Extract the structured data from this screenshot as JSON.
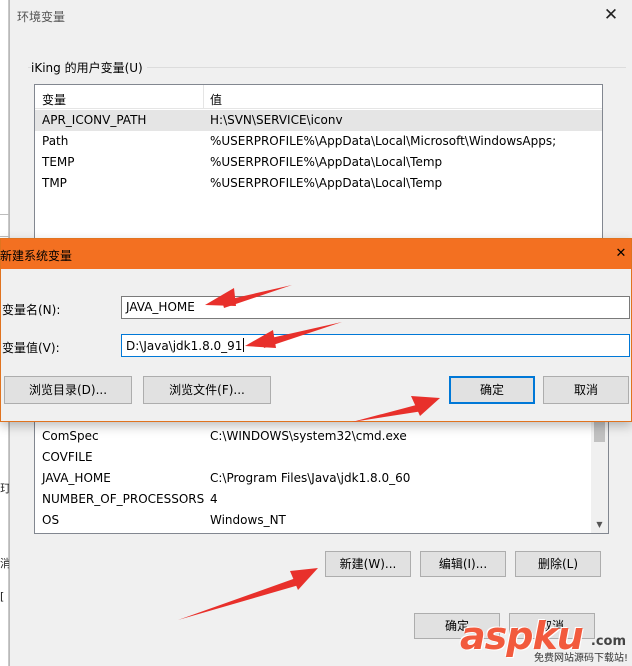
{
  "left_strip": {
    "chars": [
      "玎",
      "消",
      "["
    ]
  },
  "env_window": {
    "title": "环境变量",
    "close_glyph": "✕",
    "user_group_label": "iKing 的用户变量(U)",
    "user_vars": {
      "headers": [
        "变量",
        "值"
      ],
      "rows": [
        [
          "APR_ICONV_PATH",
          "H:\\SVN\\SERVICE\\iconv"
        ],
        [
          "Path",
          "%USERPROFILE%\\AppData\\Local\\Microsoft\\WindowsApps;"
        ],
        [
          "TEMP",
          "%USERPROFILE%\\AppData\\Local\\Temp"
        ],
        [
          "TMP",
          "%USERPROFILE%\\AppData\\Local\\Temp"
        ]
      ]
    },
    "system_vars": {
      "rows": [
        [
          "ComSpec",
          "C:\\WINDOWS\\system32\\cmd.exe"
        ],
        [
          "COVFILE",
          ""
        ],
        [
          "JAVA_HOME",
          "C:\\Program Files\\Java\\jdk1.8.0_60"
        ],
        [
          "NUMBER_OF_PROCESSORS",
          "4"
        ],
        [
          "OS",
          "Windows_NT"
        ]
      ]
    },
    "sys_buttons": {
      "new": "新建(W)...",
      "edit": "编辑(I)...",
      "delete": "删除(L)"
    },
    "footer_buttons": {
      "ok": "确定",
      "cancel": "取消"
    }
  },
  "dialog": {
    "title": "新建系统变量",
    "close_glyph": "✕",
    "name_label": "变量名(N):",
    "value_label": "变量值(V):",
    "name_value": "JAVA_HOME",
    "value_value": "D:\\Java\\jdk1.8.0_91",
    "browse_dir": "浏览目录(D)...",
    "browse_file": "浏览文件(F)...",
    "ok": "确定",
    "cancel": "取消"
  },
  "watermark": {
    "brand": "aspku",
    "domain": ".com",
    "tagline": "免费网站源码下载站!"
  },
  "colors": {
    "dialog_title_bg": "#f37021",
    "annotation_arrow": "#e8302b",
    "focus_border": "#0078d7"
  }
}
